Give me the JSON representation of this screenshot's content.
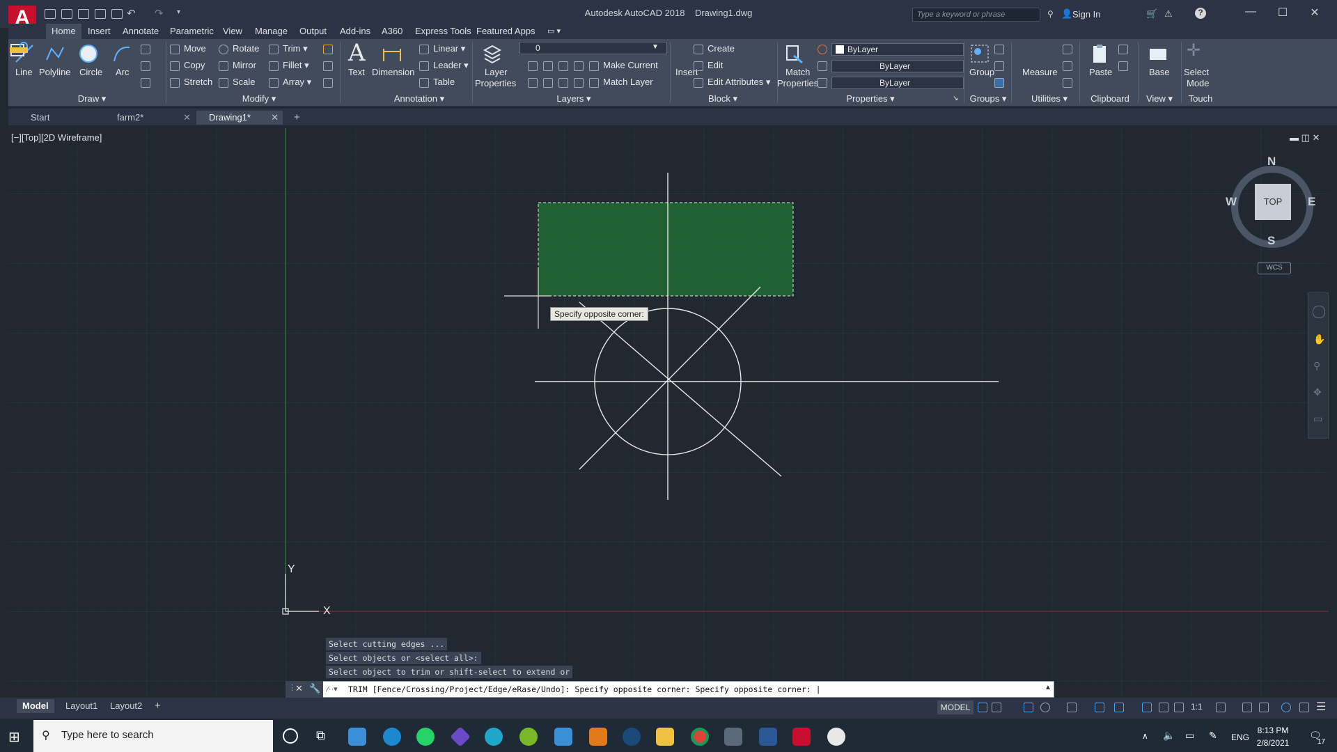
{
  "window": {
    "title": "Autodesk AutoCAD 2018",
    "document": "Drawing1.dwg",
    "search_placeholder": "Type a keyword or phrase",
    "sign_in": "Sign In"
  },
  "ribbon_tabs": [
    "Home",
    "Insert",
    "Annotate",
    "Parametric",
    "View",
    "Manage",
    "Output",
    "Add-ins",
    "A360",
    "Express Tools",
    "Featured Apps"
  ],
  "draw": {
    "panel": "Draw",
    "line": "Line",
    "polyline": "Polyline",
    "circle": "Circle",
    "arc": "Arc"
  },
  "modify": {
    "panel": "Modify",
    "move": "Move",
    "rotate": "Rotate",
    "trim": "Trim",
    "copy": "Copy",
    "mirror": "Mirror",
    "fillet": "Fillet",
    "stretch": "Stretch",
    "scale": "Scale",
    "array": "Array"
  },
  "annotation": {
    "panel": "Annotation",
    "text": "Text",
    "dimension": "Dimension",
    "linear": "Linear",
    "leader": "Leader",
    "table": "Table"
  },
  "layers": {
    "panel": "Layers",
    "layer_properties_1": "Layer",
    "layer_properties_2": "Properties",
    "current_layer": "0",
    "make_current": "Make Current",
    "match_layer": "Match Layer"
  },
  "block": {
    "panel": "Block",
    "insert": "Insert",
    "create": "Create",
    "edit": "Edit",
    "edit_attributes": "Edit Attributes"
  },
  "properties": {
    "panel": "Properties",
    "match_1": "Match",
    "match_2": "Properties",
    "color": "ByLayer",
    "linetype": "ByLayer",
    "lineweight": "ByLayer"
  },
  "groups": {
    "panel": "Groups",
    "group": "Group"
  },
  "utilities": {
    "panel": "Utilities",
    "measure": "Measure"
  },
  "clipboard": {
    "panel": "Clipboard",
    "paste": "Paste"
  },
  "view_panel": {
    "panel": "View",
    "base": "Base"
  },
  "touch": {
    "panel": "Touch",
    "select_1": "Select",
    "select_2": "Mode"
  },
  "doc_tabs": [
    "Start",
    "farm2*",
    "Drawing1*"
  ],
  "viewport_label": "[−][Top][2D Wireframe]",
  "viewcube": {
    "n": "N",
    "s": "S",
    "e": "E",
    "w": "W",
    "face": "TOP",
    "ucs": "WCS"
  },
  "tooltip": "Specify opposite corner:",
  "ucs_icon": {
    "y": "Y",
    "x": "X"
  },
  "command_history": [
    "Select cutting edges ...",
    "Select objects or <select all>:",
    "Select object to trim or shift-select to extend or"
  ],
  "command_line": "TRIM [Fence/Crossing/Project/Edge/eRase/Undo]: Specify opposite corner: Specify opposite corner: |",
  "layout_tabs": [
    "Model",
    "Layout1",
    "Layout2"
  ],
  "status": {
    "model": "MODEL",
    "scale": "1:1"
  },
  "taskbar": {
    "search_placeholder": "Type here to search",
    "lang": "ENG",
    "time": "8:13 PM",
    "date": "2/8/2021",
    "notif_count": "17"
  }
}
